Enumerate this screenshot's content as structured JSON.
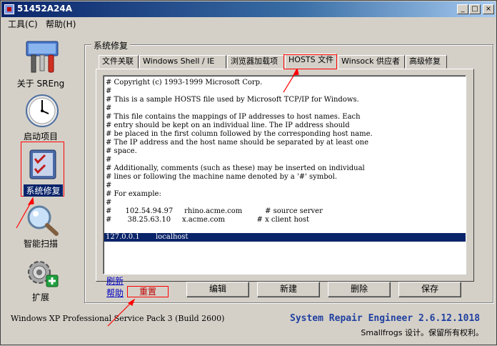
{
  "window": {
    "title": "51452A24A"
  },
  "titlebar_buttons": {
    "minimize": "_",
    "maximize": "□",
    "close": "×"
  },
  "menu": [
    {
      "label": "工具(C)"
    },
    {
      "label": "帮助(H)"
    }
  ],
  "sidebar": {
    "items": [
      {
        "label": "关于 SREng",
        "icon": "tools-icon"
      },
      {
        "label": "启动项目",
        "icon": "clock-icon"
      },
      {
        "label": "系统修复",
        "icon": "checklist-icon",
        "selected": true
      },
      {
        "label": "智能扫描",
        "icon": "magnifier-icon"
      },
      {
        "label": "扩展",
        "icon": "gear-plus-icon"
      }
    ]
  },
  "group": {
    "title": "系统修复"
  },
  "tabs": [
    {
      "label": "文件关联"
    },
    {
      "label": "Windows Shell / IE"
    },
    {
      "label": "浏览器加载项"
    },
    {
      "label": "HOSTS 文件",
      "active": true
    },
    {
      "label": "Winsock 供应者"
    },
    {
      "label": "高级修复"
    }
  ],
  "hosts": {
    "lines": [
      "# Copyright (c) 1993-1999 Microsoft Corp.",
      "#",
      "# This is a sample HOSTS file used by Microsoft TCP/IP for Windows.",
      "#",
      "# This file contains the mappings of IP addresses to host names. Each",
      "# entry should be kept on an individual line. The IP address should",
      "# be placed in the first column followed by the corresponding host name.",
      "# The IP address and the host name should be separated by at least one",
      "# space.",
      "#",
      "# Additionally, comments (such as these) may be inserted on individual",
      "# lines or following the machine name denoted by a '#' symbol.",
      "#",
      "# For example:",
      "#",
      "#      102.54.94.97     rhino.acme.com          # source server",
      "#       38.25.63.10     x.acme.com              # x client host",
      "",
      "127.0.0.1       localhost"
    ],
    "selected_index": 18
  },
  "links": {
    "refresh": "刷新",
    "help": "帮助"
  },
  "buttons": {
    "reset": "重置",
    "edit": "编辑",
    "new": "新建",
    "delete": "删除",
    "save": "保存"
  },
  "status": {
    "os": "Windows XP Professional Service Pack 3 (Build 2600)",
    "brand": "System Repair Engineer 2.6.12.1018",
    "copyright": "Smallfrogs 设计。保留所有权利。"
  },
  "colors": {
    "selection": "#0a246a",
    "annotation": "#ff0000",
    "brand": "#2040a0"
  }
}
